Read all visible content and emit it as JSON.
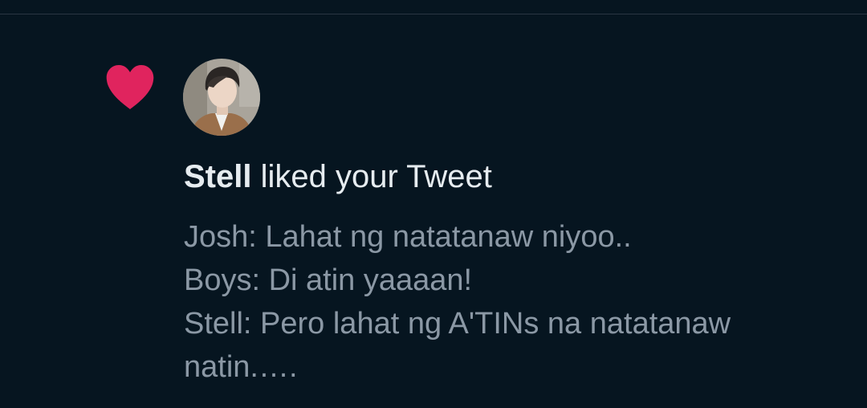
{
  "notification": {
    "type_icon": "heart-icon",
    "accent_color": "#e0245e",
    "user_name": "Stell",
    "action_text": " liked your Tweet",
    "tweet_lines": [
      "Josh: Lahat ng natatanaw niyoo..",
      "Boys: Di atin yaaaan!",
      "Stell: Pero lahat ng A'TINs na natatanaw",
      "natin.…."
    ]
  },
  "colors": {
    "background": "#061520",
    "primary_text": "#e6ecf0",
    "secondary_text": "#8b98a5"
  }
}
